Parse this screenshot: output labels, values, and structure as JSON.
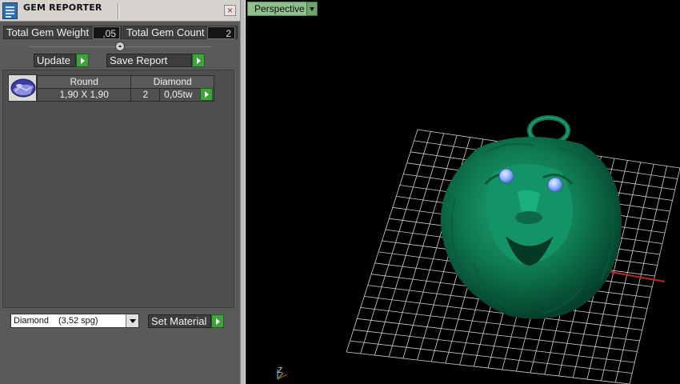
{
  "window": {
    "title": "GEM REPORTER",
    "close_icon": "close-icon"
  },
  "summary": {
    "total_weight_label": "Total Gem Weight",
    "total_weight_value": ",05",
    "total_count_label": "Total Gem Count",
    "total_count_value": "2"
  },
  "actions": {
    "update_label": "Update",
    "save_report_label": "Save Report"
  },
  "gem_list": {
    "rows": [
      {
        "icon": "round-gem-icon",
        "shape": "Round",
        "material": "Diamond",
        "size": "1,90 X 1,90",
        "count": "2",
        "weight": "0,05tw"
      }
    ]
  },
  "material_select": {
    "selected_name": "Diamond",
    "selected_density": "(3,52 spg)",
    "set_material_label": "Set Material"
  },
  "viewport": {
    "view_mode": "Perspective",
    "axis_indicator": "Z",
    "model_color": "#0f7a52",
    "gem_color": "#7fa7ff",
    "grid_color": "#cfcfcf",
    "axis_color": "#c0261f"
  }
}
